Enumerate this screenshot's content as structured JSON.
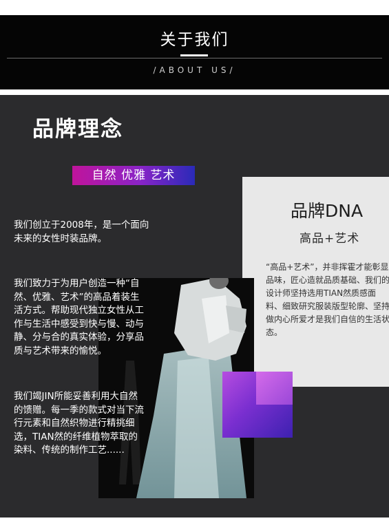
{
  "header": {
    "title": "关于我们",
    "subtitle": "/ABOUT US/"
  },
  "brand": {
    "title": "品牌理念",
    "tagline": "自然 优雅 艺术",
    "paragraph1": "我们创立于2008年，是一个面向未来的女性时装品牌。",
    "paragraph2": "我们致力于为用户创造一种“自然、优雅、艺术”的高品着装生活方式。帮助现代独立女性从工作与生活中感受到快与慢、动与静、分与合的真实体验，分享品质与艺术带来的愉悦。",
    "paragraph3": "我们竭JIN所能妥善利用大自然的馈赠。每一季的款式对当下流行元素和自然织物进行精挑细选，TIAN然的纤维植物萃取的染料、传统的制作工艺......"
  },
  "dna": {
    "title": "品牌DNA",
    "subtitle": "高品+艺术",
    "text": "“高品+艺术”，并非挥霍才能彰显品味，匠心造就品质基础、我们的设计师坚持选用TIAN然质感面料、细致研究服装版型轮廓、坚持做内心所爱才是我们自信的生活状态。"
  },
  "colors": {
    "background_dark": "#2b2b2d",
    "header_black": "#050505",
    "accent_magenta": "#c0149b",
    "accent_purple": "#8a24c7",
    "accent_blue": "#2a2ab8"
  }
}
